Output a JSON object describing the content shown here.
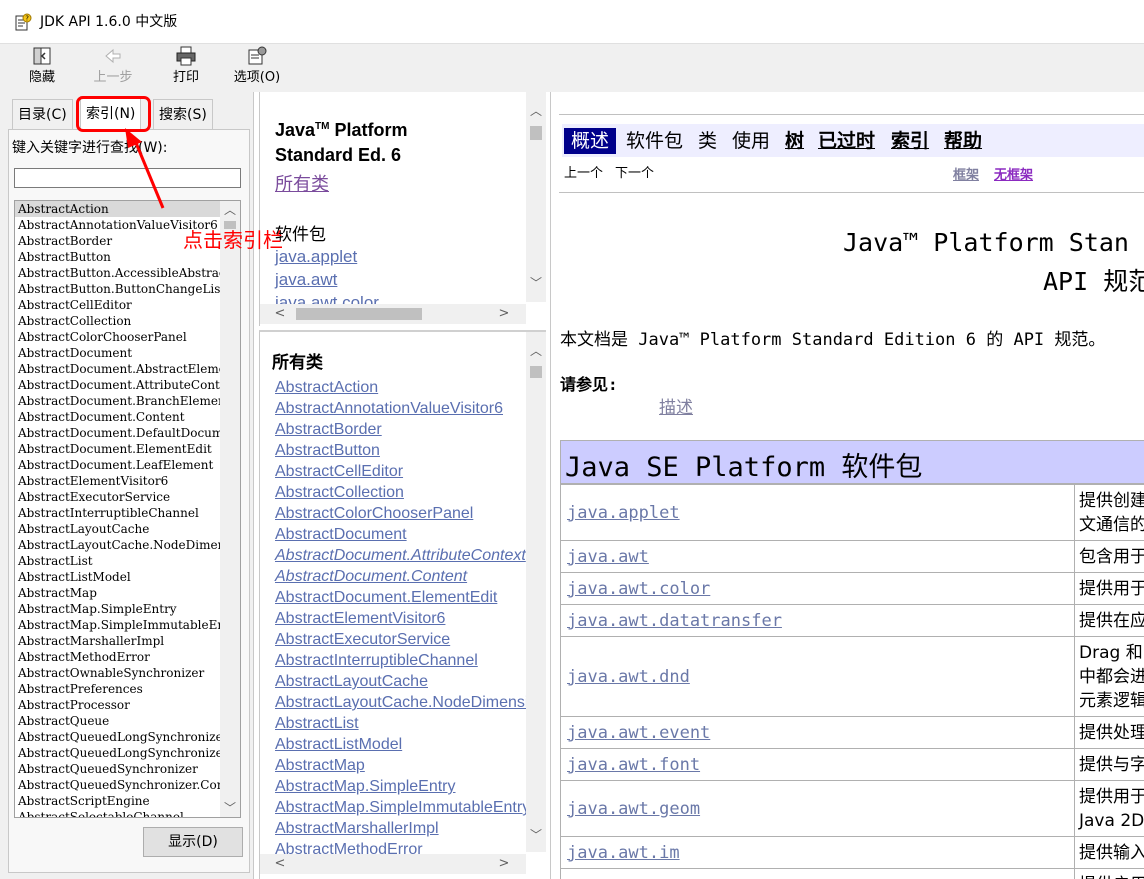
{
  "window": {
    "title": "JDK API 1.6.0 中文版"
  },
  "toolbar": {
    "hide": "隐藏",
    "back": "上一步",
    "print": "打印",
    "options": "选项(O)"
  },
  "tabs": {
    "contents": "目录(C)",
    "index": "索引(N)",
    "search": "搜索(S)"
  },
  "index_panel": {
    "keyword_label": "键入关键字进行查找(W):",
    "keyword_value": "",
    "show_button": "显示(D)",
    "items": [
      "AbstractAction",
      "AbstractAnnotationValueVisitor6",
      "AbstractBorder",
      "AbstractButton",
      "AbstractButton.AccessibleAbstractBu",
      "AbstractButton.ButtonChangeListene",
      "AbstractCellEditor",
      "AbstractCollection",
      "AbstractColorChooserPanel",
      "AbstractDocument",
      "AbstractDocument.AbstractElement",
      "AbstractDocument.AttributeContext",
      "AbstractDocument.BranchElement",
      "AbstractDocument.Content",
      "AbstractDocument.DefaultDocument",
      "AbstractDocument.ElementEdit",
      "AbstractDocument.LeafElement",
      "AbstractElementVisitor6",
      "AbstractExecutorService",
      "AbstractInterruptibleChannel",
      "AbstractLayoutCache",
      "AbstractLayoutCache.NodeDimensio",
      "AbstractList",
      "AbstractListModel",
      "AbstractMap",
      "AbstractMap.SimpleEntry",
      "AbstractMap.SimpleImmutableEntry",
      "AbstractMarshallerImpl",
      "AbstractMethodError",
      "AbstractOwnableSynchronizer",
      "AbstractPreferences",
      "AbstractProcessor",
      "AbstractQueue",
      "AbstractQueuedLongSynchronizer",
      "AbstractQueuedLongSynchronizer.C",
      "AbstractQueuedSynchronizer",
      "AbstractQueuedSynchronizer.Condi",
      "AbstractScriptEngine",
      "AbstractSelectableChannel"
    ]
  },
  "annotation": {
    "text": "点击索引栏",
    "color": "#ff0000"
  },
  "overview_frame": {
    "title_line1": "Java",
    "tm": "TM",
    "title_line1_rest": " Platform",
    "title_line2": "Standard Ed. 6",
    "all_classes": "所有类",
    "packages_heading": "软件包",
    "packages": [
      "java.applet",
      "java.awt",
      "java.awt.color"
    ]
  },
  "classes_frame": {
    "heading": "所有类",
    "classes": [
      {
        "name": "AbstractAction",
        "italic": false
      },
      {
        "name": "AbstractAnnotationValueVisitor6",
        "italic": false
      },
      {
        "name": "AbstractBorder",
        "italic": false
      },
      {
        "name": "AbstractButton",
        "italic": false
      },
      {
        "name": "AbstractCellEditor",
        "italic": false
      },
      {
        "name": "AbstractCollection",
        "italic": false
      },
      {
        "name": "AbstractColorChooserPanel",
        "italic": false
      },
      {
        "name": "AbstractDocument",
        "italic": false
      },
      {
        "name": "AbstractDocument.AttributeContext",
        "italic": true
      },
      {
        "name": "AbstractDocument.Content",
        "italic": true
      },
      {
        "name": "AbstractDocument.ElementEdit",
        "italic": false
      },
      {
        "name": "AbstractElementVisitor6",
        "italic": false
      },
      {
        "name": "AbstractExecutorService",
        "italic": false
      },
      {
        "name": "AbstractInterruptibleChannel",
        "italic": false
      },
      {
        "name": "AbstractLayoutCache",
        "italic": false
      },
      {
        "name": "AbstractLayoutCache.NodeDimensions",
        "italic": false
      },
      {
        "name": "AbstractList",
        "italic": false
      },
      {
        "name": "AbstractListModel",
        "italic": false
      },
      {
        "name": "AbstractMap",
        "italic": false
      },
      {
        "name": "AbstractMap.SimpleEntry",
        "italic": false
      },
      {
        "name": "AbstractMap.SimpleImmutableEntry",
        "italic": false
      },
      {
        "name": "AbstractMarshallerImpl",
        "italic": false
      },
      {
        "name": "AbstractMethodError",
        "italic": false
      }
    ]
  },
  "content_frame": {
    "nav": {
      "overview": "概述",
      "package": "软件包",
      "class": "类",
      "use": "使用",
      "tree": "树",
      "deprecated": "已过时",
      "index": "索引",
      "help": "帮助"
    },
    "prev": "上一个",
    "next": "下一个",
    "frames": "框架",
    "no_frames": "无框架",
    "heading_line1": "Java™ Platform Stan",
    "heading_line2": "API 规范",
    "intro": "本文档是 Java™ Platform Standard Edition 6 的 API 规范。",
    "see_also": "请参见:",
    "description_link": "描述",
    "table_heading": "Java SE Platform 软件包",
    "table_heading_bg": "#ccccff",
    "packages": [
      {
        "name": "java.applet",
        "desc": [
          "提供创建",
          "文通信的"
        ]
      },
      {
        "name": "java.awt",
        "desc": [
          "包含用于"
        ]
      },
      {
        "name": "java.awt.color",
        "desc": [
          "提供用于"
        ]
      },
      {
        "name": "java.awt.datatransfer",
        "desc": [
          "提供在应"
        ]
      },
      {
        "name": "java.awt.dnd",
        "desc": [
          "Drag 和",
          "中都会进",
          "元素逻辑"
        ]
      },
      {
        "name": "java.awt.event",
        "desc": [
          "提供处理"
        ]
      },
      {
        "name": "java.awt.font",
        "desc": [
          "提供与字"
        ]
      },
      {
        "name": "java.awt.geom",
        "desc": [
          "提供用于",
          "Java 2D"
        ]
      },
      {
        "name": "java.awt.im",
        "desc": [
          "提供输入"
        ]
      },
      {
        "name": "",
        "desc": [
          "提供启用"
        ]
      }
    ]
  }
}
